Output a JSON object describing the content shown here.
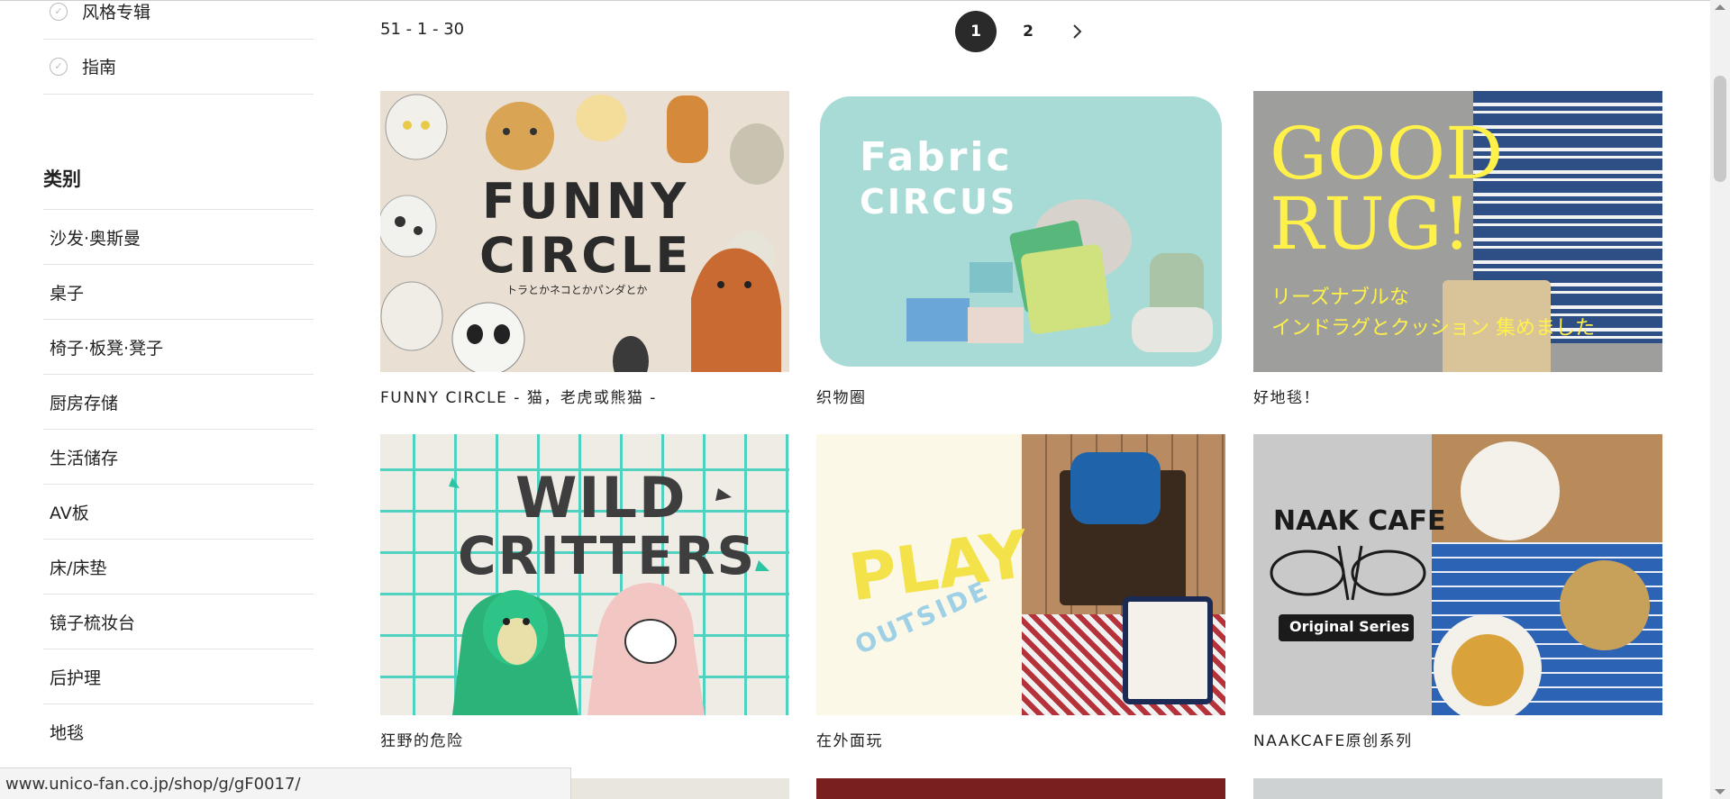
{
  "sidebar": {
    "top_items": [
      {
        "label": "风格专辑"
      },
      {
        "label": "指南"
      }
    ],
    "category_heading": "类别",
    "categories": [
      {
        "label": "沙发·奥斯曼"
      },
      {
        "label": "桌子"
      },
      {
        "label": "椅子·板凳·凳子"
      },
      {
        "label": "厨房存储"
      },
      {
        "label": "生活储存"
      },
      {
        "label": "AV板"
      },
      {
        "label": "床/床垫"
      },
      {
        "label": "镜子梳妆台"
      },
      {
        "label": "后护理"
      },
      {
        "label": "地毯"
      }
    ]
  },
  "results": {
    "count_text": "51 - 1 - 30",
    "pagination": {
      "pages": [
        "1",
        "2"
      ],
      "current": "1",
      "next_icon": "chevron-right-icon"
    }
  },
  "cards": [
    {
      "caption": "FUNNY CIRCLE - 猫，老虎或熊猫 -",
      "art": {
        "title_line1": "FUNNY",
        "title_line2": "CIRCLE",
        "subtitle": "トラとかネコとかパンダとか"
      },
      "colors": {
        "bg": "#e9dfd2",
        "text": "#2b2b2b"
      }
    },
    {
      "caption": "织物圈",
      "art": {
        "title_line1": "Fabric",
        "title_line2": "CIRCUS"
      },
      "colors": {
        "bg": "#ffffff",
        "panel": "#a9dbd6",
        "text": "#ffffff"
      }
    },
    {
      "caption": "好地毯！",
      "art": {
        "title_line1": "GOOD",
        "title_line2": "RUG!",
        "subtitle_line1": "リーズナブルな",
        "subtitle_line2": "インドラグとクッション 集めました"
      },
      "colors": {
        "bg": "#9e9e9c",
        "text": "#fff14a",
        "stripe": "#2e4e86"
      }
    },
    {
      "caption": "狂野的危险",
      "art": {
        "title_line1": "WILD",
        "title_line2": "CRITTERS"
      },
      "colors": {
        "bg": "#efece6",
        "grid": "#3fd0bd",
        "text": "#3e3e3e"
      }
    },
    {
      "caption": "在外面玩",
      "art": {
        "title_line1": "PLAY",
        "title_line2": "OUTSIDE"
      },
      "colors": {
        "bg": "#fbf8e8",
        "text": "#f4e24a",
        "text2": "#9ed0e6",
        "photo": "#b98b63"
      }
    },
    {
      "caption": "NAAKCAFE原创系列",
      "art": {
        "title_line1": "NAAK CAFE",
        "title_line2": "Original Series"
      },
      "colors": {
        "bg": "#c9c9c9",
        "text": "#1b1b1b",
        "photo": "#2c63b5"
      }
    }
  ],
  "statusbar": {
    "url": "www.unico-fan.co.jp/shop/g/gF0017/"
  }
}
